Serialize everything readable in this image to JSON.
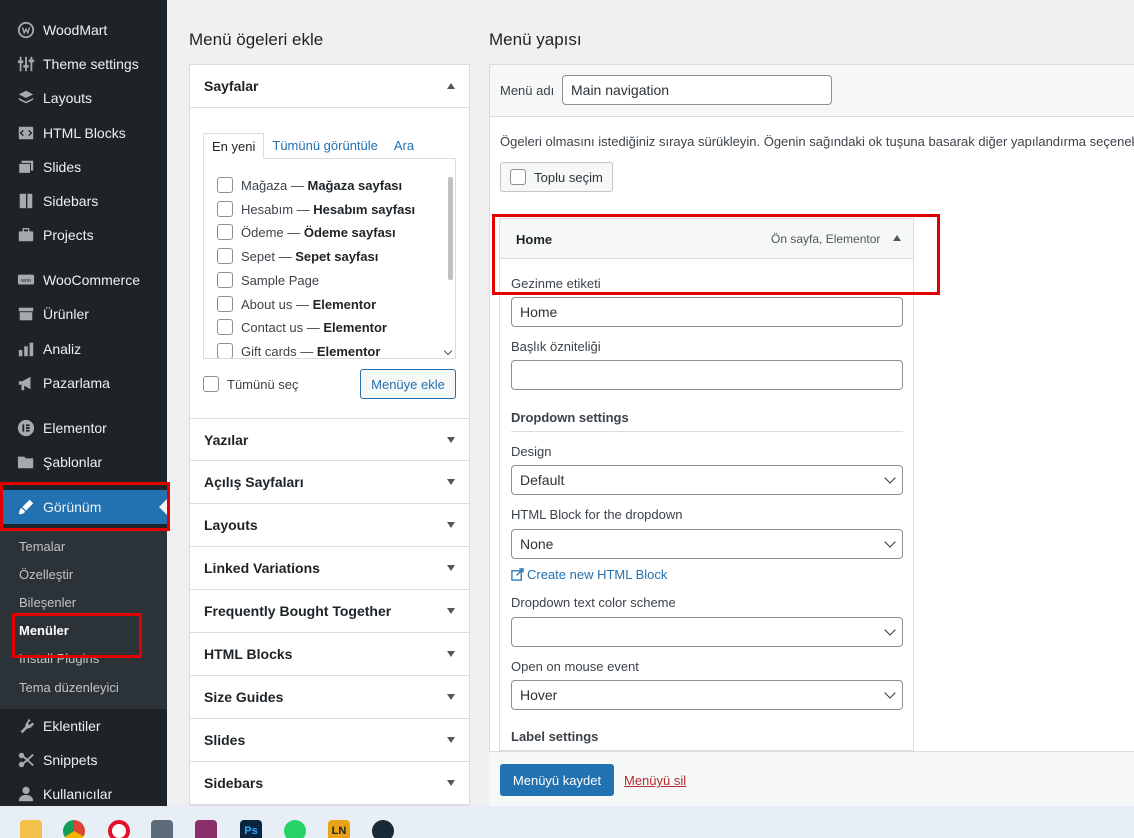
{
  "sidebar": {
    "items": [
      {
        "label": "WoodMart",
        "icon": "woodmart-icon"
      },
      {
        "label": "Theme settings",
        "icon": "sliders-icon"
      },
      {
        "label": "Layouts",
        "icon": "layers-icon"
      },
      {
        "label": "HTML Blocks",
        "icon": "html-icon"
      },
      {
        "label": "Slides",
        "icon": "slides-icon"
      },
      {
        "label": "Sidebars",
        "icon": "sidebar-icon"
      },
      {
        "label": "Projects",
        "icon": "briefcase-icon"
      },
      {
        "label": "WooCommerce",
        "icon": "woo-icon"
      },
      {
        "label": "Ürünler",
        "icon": "archive-icon"
      },
      {
        "label": "Analiz",
        "icon": "chart-icon"
      },
      {
        "label": "Pazarlama",
        "icon": "megaphone-icon"
      },
      {
        "label": "Elementor",
        "icon": "elementor-icon"
      },
      {
        "label": "Şablonlar",
        "icon": "folder-icon"
      },
      {
        "label": "Görünüm",
        "icon": "brush-icon"
      },
      {
        "label": "Eklentiler",
        "icon": "plugin-icon"
      },
      {
        "label": "Snippets",
        "icon": "snippets-icon"
      },
      {
        "label": "Kullanıcılar",
        "icon": "user-icon"
      }
    ],
    "submenu": [
      "Temalar",
      "Özelleştir",
      "Bileşenler",
      "Menüler",
      "Install Plugins",
      "Tema düzenleyici"
    ],
    "active_item": "Görünüm",
    "current_submenu": "Menüler"
  },
  "add_items": {
    "title": "Menü ögeleri ekle",
    "pages_section": "Sayfalar",
    "tabs": [
      "En yeni",
      "Tümünü görüntüle",
      "Ara"
    ],
    "pages": [
      {
        "name": "Mağaza",
        "sep": " — ",
        "note": "Mağaza sayfası"
      },
      {
        "name": "Hesabım",
        "sep": " — ",
        "note": "Hesabım sayfası"
      },
      {
        "name": "Ödeme",
        "sep": " — ",
        "note": "Ödeme sayfası"
      },
      {
        "name": "Sepet",
        "sep": " — ",
        "note": "Sepet sayfası"
      },
      {
        "name": "Sample Page",
        "sep": "",
        "note": ""
      },
      {
        "name": "About us",
        "sep": " — ",
        "note": "Elementor"
      },
      {
        "name": "Contact us",
        "sep": " — ",
        "note": "Elementor"
      },
      {
        "name": "Gift cards",
        "sep": " — ",
        "note": "Elementor"
      }
    ],
    "select_all_label": "Tümünü seç",
    "add_button": "Menüye ekle",
    "sections": [
      "Yazılar",
      "Açılış Sayfaları",
      "Layouts",
      "Linked Variations",
      "Frequently Bought Together",
      "HTML Blocks",
      "Size Guides",
      "Slides",
      "Sidebars"
    ]
  },
  "menu_structure": {
    "title": "Menü yapısı",
    "menu_name_label": "Menü adı",
    "menu_name_value": "Main navigation",
    "instructions": "Ögeleri olmasını istediğiniz sıraya sürükleyin. Ögenin sağındaki ok tuşuna basarak diğer yapılandırma seçenekle",
    "bulk_select_label": "Toplu seçim",
    "item": {
      "title": "Home",
      "meta": "Ön sayfa, Elementor",
      "nav_label_label": "Gezinme etiketi",
      "nav_label_value": "Home",
      "title_attr_label": "Başlık özniteliği",
      "title_attr_value": "",
      "dropdown_settings_title": "Dropdown settings",
      "design_label": "Design",
      "design_value": "Default",
      "html_block_label": "HTML Block for the dropdown",
      "html_block_value": "None",
      "create_html_block_link": "Create new HTML Block",
      "color_scheme_label": "Dropdown text color scheme",
      "color_scheme_value": "",
      "mouse_event_label": "Open on mouse event",
      "mouse_event_value": "Hover",
      "label_settings_title": "Label settings"
    },
    "save_button": "Menüyü kaydet",
    "delete_link": "Menüyü sil"
  },
  "taskbar": {
    "apps": [
      "file-explorer-icon",
      "chrome-icon",
      "opera-icon",
      "calculator-icon",
      "winrar-icon",
      "photoshop-icon",
      "whatsapp-icon",
      "ln-icon",
      "steam-icon"
    ],
    "photoshop_label": "Ps",
    "ln_label": "LN"
  },
  "colors": {
    "sidebar_bg": "#1d2327",
    "accent": "#2271b1",
    "highlight": "#e00000",
    "delete_link": "#b32d2e"
  }
}
